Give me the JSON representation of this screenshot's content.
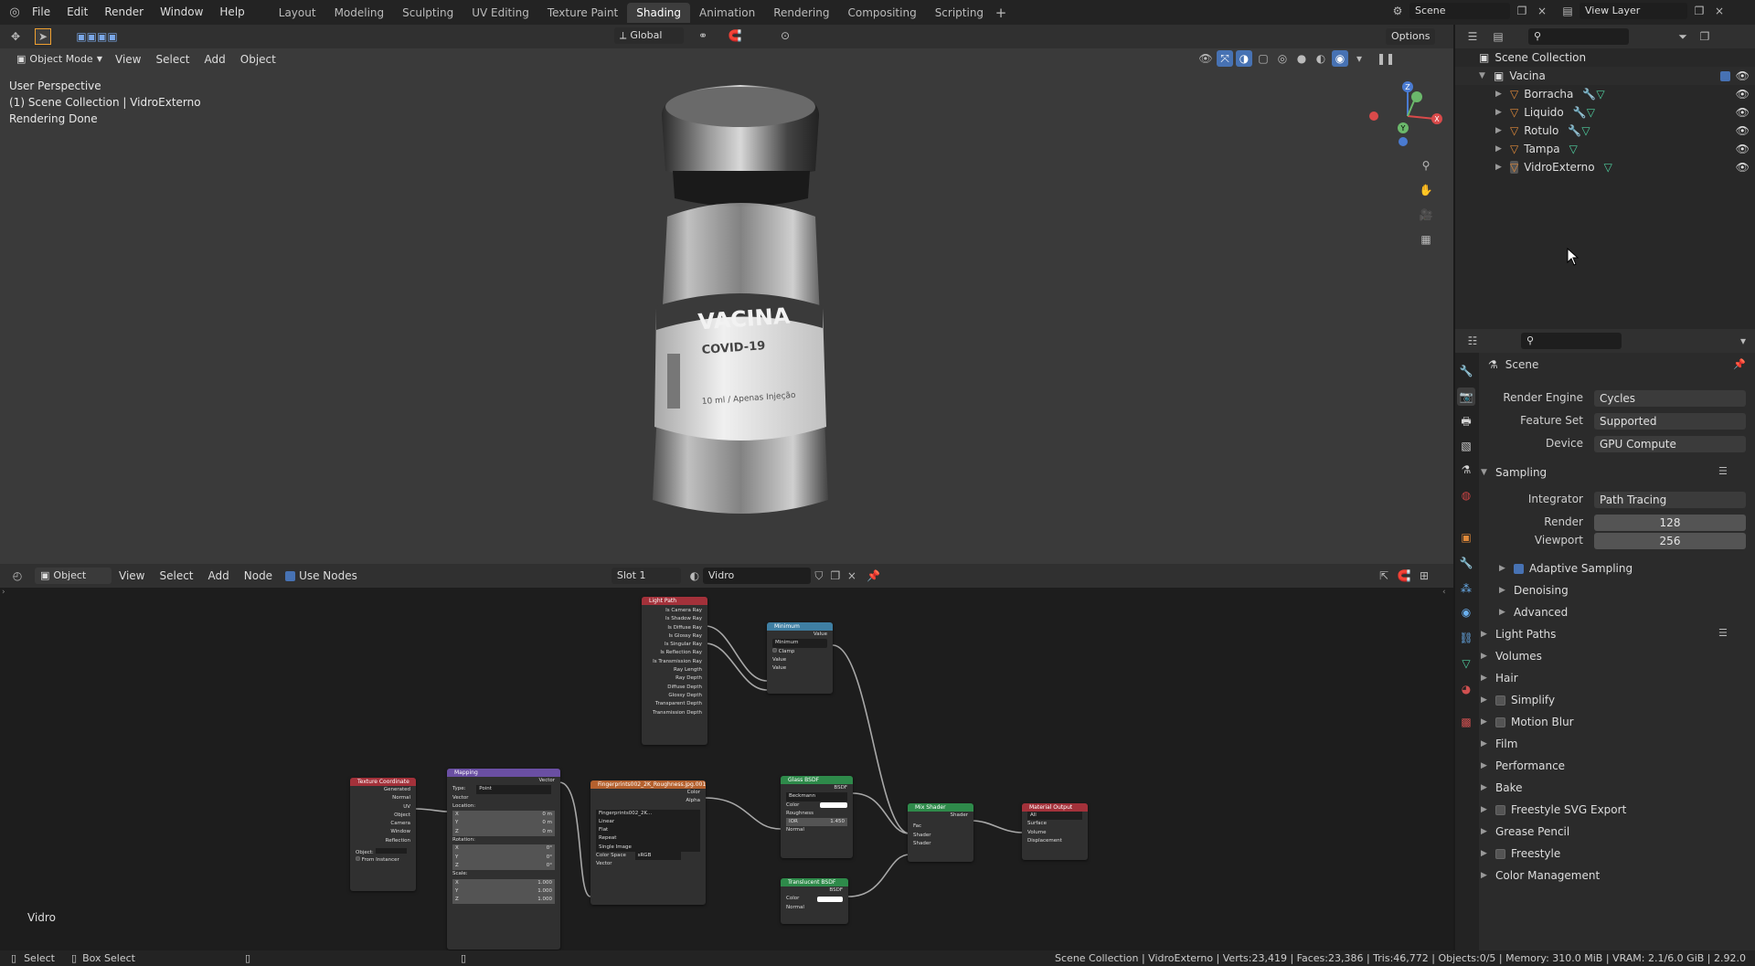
{
  "topbar": {
    "menus": [
      "File",
      "Edit",
      "Render",
      "Window",
      "Help"
    ],
    "workspaces": [
      "Layout",
      "Modeling",
      "Sculpting",
      "UV Editing",
      "Texture Paint",
      "Shading",
      "Animation",
      "Rendering",
      "Compositing",
      "Scripting"
    ],
    "active_workspace": "Shading",
    "scene": "Scene",
    "view_layer": "View Layer"
  },
  "viewport": {
    "mode": "Object Mode",
    "menus": [
      "View",
      "Select",
      "Add",
      "Object"
    ],
    "orientation": "Global",
    "options": "Options",
    "overlay_lines": [
      "User Perspective",
      "(1) Scene Collection | VidroExterno",
      "Rendering Done"
    ],
    "label_vacina": "VACINA",
    "label_covid": "COVID-19",
    "label_volume": "10 ml / Apenas Injeção",
    "gizmo": {
      "x": "X",
      "y": "Y",
      "z": "Z"
    }
  },
  "node_editor": {
    "type": "Object",
    "menus": [
      "View",
      "Select",
      "Add",
      "Node"
    ],
    "use_nodes": "Use Nodes",
    "slot": "Slot 1",
    "material": "Vidro",
    "footer_label": "Vidro",
    "nodes": {
      "light_path": {
        "title": "Light Path",
        "outputs": [
          "Is Camera Ray",
          "Is Shadow Ray",
          "Is Diffuse Ray",
          "Is Glossy Ray",
          "Is Singular Ray",
          "Is Reflection Ray",
          "Is Transmission Ray",
          "Ray Length",
          "Ray Depth",
          "Diffuse Depth",
          "Glossy Depth",
          "Transparent Depth",
          "Transmission Depth"
        ]
      },
      "minimum": {
        "title": "Minimum",
        "output": "Value",
        "mode": "Minimum",
        "clamp": "Clamp",
        "in1": "Value",
        "in2": "Value"
      },
      "texcoord": {
        "title": "Texture Coordinate",
        "outputs": [
          "Generated",
          "Normal",
          "UV",
          "Object",
          "Camera",
          "Window",
          "Reflection"
        ],
        "object": "Object:",
        "from_instancer": "From Instancer"
      },
      "mapping": {
        "title": "Mapping",
        "output": "Vector",
        "type_label": "Type:",
        "type": "Point",
        "vector": "Vector",
        "location": "Location:",
        "loc": [
          "0 m",
          "0 m",
          "0 m"
        ],
        "rotation": "Rotation:",
        "rot": [
          "0°",
          "0°",
          "0°"
        ],
        "scale": "Scale:",
        "scl": [
          "1.000",
          "1.000",
          "1.000"
        ],
        "axes": [
          "X",
          "Y",
          "Z"
        ]
      },
      "image": {
        "title": "Fingerprints002_2K_Roughness.jpg.001",
        "out_color": "Color",
        "out_alpha": "Alpha",
        "file": "Fingerprints002_2K...",
        "interp": "Linear",
        "proj": "Flat",
        "ext": "Repeat",
        "src": "Single Image",
        "cs_label": "Color Space",
        "cs": "sRGB",
        "in": "Vector"
      },
      "glass": {
        "title": "Glass BSDF",
        "out": "BSDF",
        "dist": "Beckmann",
        "color": "Color",
        "rough": "Roughness",
        "ior_label": "IOR",
        "ior": "1.450",
        "normal": "Normal"
      },
      "translucent": {
        "title": "Translucent BSDF",
        "out": "BSDF",
        "color": "Color",
        "normal": "Normal"
      },
      "mix": {
        "title": "Mix Shader",
        "out": "Shader",
        "fac": "Fac",
        "s1": "Shader",
        "s2": "Shader"
      },
      "output": {
        "title": "Material Output",
        "target": "All",
        "surface": "Surface",
        "volume": "Volume",
        "disp": "Displacement"
      }
    }
  },
  "outliner": {
    "root": "Scene Collection",
    "collection": "Vacina",
    "objects": [
      "Borracha",
      "Liquido",
      "Rotulo",
      "Tampa",
      "VidroExterno"
    ]
  },
  "properties": {
    "context": "Scene",
    "render_engine_label": "Render Engine",
    "render_engine": "Cycles",
    "feature_set_label": "Feature Set",
    "feature_set": "Supported",
    "device_label": "Device",
    "device": "GPU Compute",
    "sampling": "Sampling",
    "integrator_label": "Integrator",
    "integrator": "Path Tracing",
    "render_label": "Render",
    "render_samples": "128",
    "viewport_label": "Viewport",
    "viewport_samples": "256",
    "sub": [
      "Adaptive Sampling",
      "Denoising",
      "Advanced"
    ],
    "panels": [
      "Light Paths",
      "Volumes",
      "Hair",
      "Simplify",
      "Motion Blur",
      "Film",
      "Performance",
      "Bake",
      "Freestyle SVG Export",
      "Grease Pencil",
      "Freestyle",
      "Color Management"
    ]
  },
  "statusbar": {
    "select": "Select",
    "box_select": "Box Select",
    "stats": "Scene Collection | VidroExterno | Verts:23,419 | Faces:23,386 | Tris:46,772 | Objects:0/5 | Memory: 310.0 MiB | VRAM: 2.1/6.0 GiB | 2.92.0"
  },
  "colors": {
    "accent": "#4772b3",
    "active_tab": "#3d3d3d",
    "node_input": "#a1a1a1"
  }
}
